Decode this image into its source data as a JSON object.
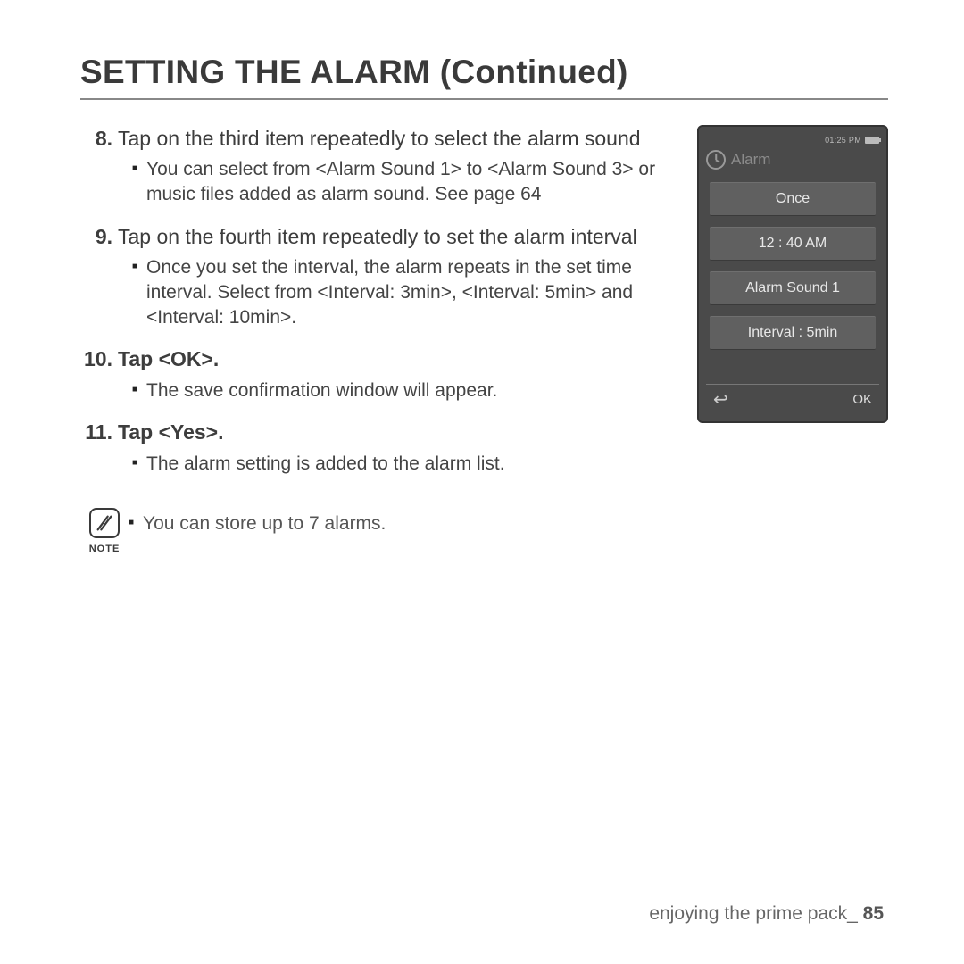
{
  "title": "SETTING THE ALARM (Continued)",
  "steps": [
    {
      "num": "8.",
      "text": "Tap on the third item repeatedly to select the alarm sound",
      "bold": false,
      "sub": "You can select from <Alarm Sound 1> to <Alarm Sound 3> or music files added as alarm sound. See page 64"
    },
    {
      "num": "9.",
      "text": "Tap on the fourth item repeatedly to set the alarm interval",
      "bold": false,
      "sub": "Once you set the interval, the alarm repeats in the set time interval. Select from <Interval: 3min>, <Interval: 5min> and <Interval: 10min>."
    },
    {
      "num": "10.",
      "text": "Tap <OK>.",
      "bold": true,
      "sub": "The save confirmation window will appear."
    },
    {
      "num": "11.",
      "text": "Tap <Yes>.",
      "bold": true,
      "sub": "The alarm setting is added to the alarm list."
    }
  ],
  "note": {
    "label": "NOTE",
    "text": "You can store up to 7 alarms."
  },
  "device": {
    "status_time": "01:25 PM",
    "title": "Alarm",
    "options": [
      "Once",
      "12 : 40 AM",
      "Alarm Sound 1",
      "Interval : 5min"
    ],
    "ok": "OK"
  },
  "footer": {
    "section": "enjoying the prime pack_",
    "page": "85"
  }
}
